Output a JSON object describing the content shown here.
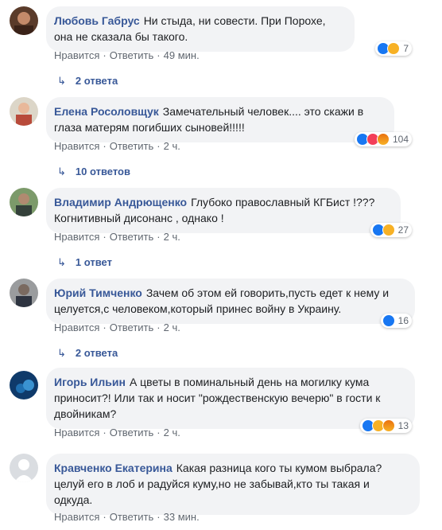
{
  "labels": {
    "like": "Нравится",
    "reply": "Ответить",
    "dot": "·"
  },
  "comments": [
    {
      "author": "Любовь Габрус",
      "text": "Ни стыда, ни совести. При Порохе, она не сказала бы такого.",
      "time": "49 мин.",
      "reactions": [
        "like",
        "sad"
      ],
      "reaction_count": "7",
      "replies": "2 ответа"
    },
    {
      "author": "Елена Росоловщук",
      "text": "Замечательный человек.... это скажи в глаза матерям погибших сыновей!!!!!",
      "time": "2 ч.",
      "reactions": [
        "like",
        "heart",
        "angry"
      ],
      "reaction_count": "104",
      "replies": "10 ответов"
    },
    {
      "author": "Владимир Андрющенко",
      "text": "Глубоко православный КГБист !??? Когнитивный дисонанс , однако !",
      "time": "2 ч.",
      "reactions": [
        "like",
        "haha"
      ],
      "reaction_count": "27",
      "replies": "1 ответ"
    },
    {
      "author": "Юрий Тимченко",
      "text": "Зачем об этом ей говорить,пусть едет к нему и целуется,с человеком,который принес войну в Украину.",
      "time": "2 ч.",
      "reactions": [
        "like"
      ],
      "reaction_count": "16",
      "replies": "2 ответа"
    },
    {
      "author": "Игорь Ильин",
      "text": "А цветы в поминальный день на могилку кума приносит?! Или так и носит \"рождественскую вечерю\" в гости к двойникам?",
      "time": "2 ч.",
      "reactions": [
        "like",
        "haha",
        "angry"
      ],
      "reaction_count": "13",
      "replies": ""
    },
    {
      "author": "Кравченко Екатерина",
      "text": "Какая разница кого ты кумом выбрала?целуй его в лоб и радуйся куму,но не забывай,кто ты такая и одкуда.",
      "time": "33 мин.",
      "reactions": [],
      "reaction_count": "",
      "replies": ""
    }
  ]
}
